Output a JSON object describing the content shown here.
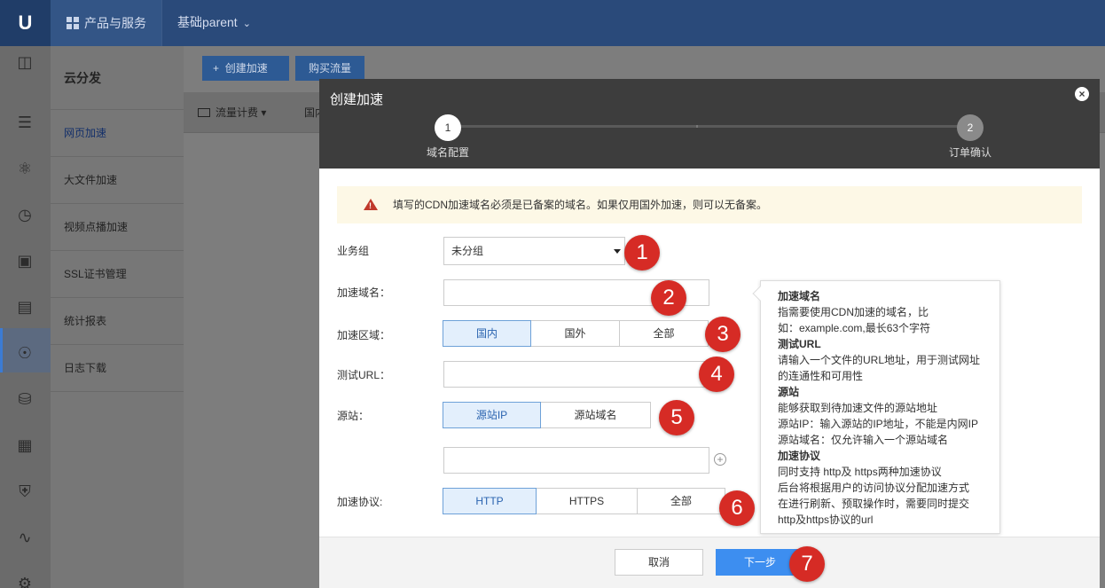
{
  "topbar": {
    "logo": "U",
    "nav_label": "产品与服务",
    "org_label": "基础parent"
  },
  "rail_icons": [
    "monitor-icon",
    "list-icon",
    "sitemap-icon",
    "meter-icon",
    "id-card-icon",
    "document-icon",
    "cdn-icon",
    "database-icon",
    "apps-icon",
    "shield-icon",
    "pulse-icon",
    "settings-icon"
  ],
  "sidebar": {
    "title": "云分发",
    "items": [
      {
        "label": "网页加速"
      },
      {
        "label": "大文件加速"
      },
      {
        "label": "视频点播加速"
      },
      {
        "label": "SSL证书管理"
      },
      {
        "label": "统计报表"
      },
      {
        "label": "日志下载"
      }
    ]
  },
  "toolbar": {
    "create_label": "创建加速",
    "buy_label": "购买流量",
    "filter_billing": "流量计费",
    "filter_region": "国内"
  },
  "modal": {
    "title": "创建加速",
    "close": "×",
    "steps": [
      {
        "num": "1",
        "label": "域名配置"
      },
      {
        "num": "2",
        "label": "订单确认"
      }
    ],
    "warning": "填写的CDN加速域名必须是已备案的域名。如果仅用国外加速，则可以无备案。",
    "form": {
      "group_label": "业务组",
      "group_value": "未分组",
      "domain_label": "加速域名：",
      "region_label": "加速区域：",
      "region_options": [
        "国内",
        "国外",
        "全部"
      ],
      "region_selected": "国内",
      "test_url_label": "测试URL：",
      "origin_label": "源站：",
      "origin_options": [
        "源站IP",
        "源站域名"
      ],
      "origin_selected": "源站IP",
      "protocol_label": "加速协议:",
      "protocol_options": [
        "HTTP",
        "HTTPS",
        "全部"
      ],
      "protocol_selected": "HTTP"
    },
    "tooltip": [
      {
        "type": "h",
        "text": "加速域名"
      },
      {
        "type": "p",
        "text": "指需要使用CDN加速的域名，比"
      },
      {
        "type": "p",
        "text": "如：example.com,最长63个字符"
      },
      {
        "type": "h",
        "text": "测试URL"
      },
      {
        "type": "p",
        "text": "请输入一个文件的URL地址，用于测试网址"
      },
      {
        "type": "p",
        "text": "的连通性和可用性"
      },
      {
        "type": "h",
        "text": "源站"
      },
      {
        "type": "p",
        "text": "能够获取到待加速文件的源站地址"
      },
      {
        "type": "p",
        "text": "源站IP：输入源站的IP地址，不能是内网IP"
      },
      {
        "type": "p",
        "text": "源站域名：仅允许输入一个源站域名"
      },
      {
        "type": "h",
        "text": "加速协议"
      },
      {
        "type": "p",
        "text": "同时支持 http及 https两种加速协议"
      },
      {
        "type": "p",
        "text": "后台将根据用户的访问协议分配加速方式"
      },
      {
        "type": "p",
        "text": "在进行刷新、预取操作时，需要同时提交"
      },
      {
        "type": "p",
        "text": "http及https协议的url"
      }
    ],
    "cancel_label": "取消",
    "next_label": "下一步"
  },
  "annotations": [
    "1",
    "2",
    "3",
    "4",
    "5",
    "6",
    "7"
  ],
  "colors": {
    "accent": "#3d8ef0",
    "annotation_red": "#d62b25",
    "topbar": "#2a4a7a"
  }
}
